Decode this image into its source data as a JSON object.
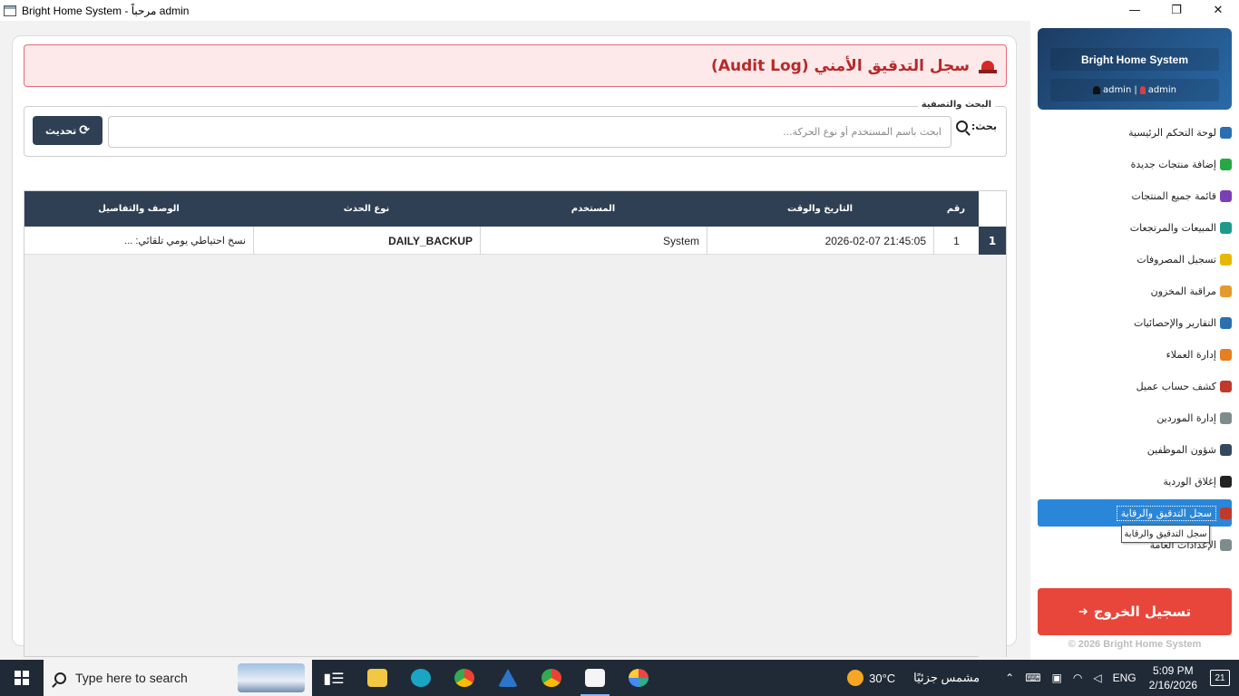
{
  "window": {
    "title": "Bright Home System - مرحباً admin",
    "minimize": "—",
    "maximize": "❐",
    "close": "✕"
  },
  "header": {
    "title": "سجل التدقيق الأمني (Audit Log)"
  },
  "filter": {
    "legend": "البحث والتصفية",
    "search_label": "بحث:",
    "search_placeholder": "ابحث باسم المستخدم أو نوع الحركة...",
    "search_value": "",
    "refresh_label": "تحديث",
    "refresh_icon": "⟳"
  },
  "table": {
    "columns": [
      "رقم",
      "التاريخ والوقت",
      "المستخدم",
      "نوع الحدث",
      "الوصف والتفاصيل"
    ],
    "rows": [
      {
        "row_header": "1",
        "id": "1",
        "datetime": "2026-02-07 21:45:05",
        "user": "System",
        "event_type": "DAILY_BACKUP",
        "description": "نسخ احتياطي يومي تلقائي: ..."
      }
    ]
  },
  "sidebar": {
    "brand_name": "Bright Home System",
    "user_left": "admin",
    "user_sep": "|",
    "user_right": "admin",
    "items": [
      {
        "label": "لوحة التحكم الرئيسية",
        "icon": "dashboard-icon",
        "color": "#2a6fb0"
      },
      {
        "label": "إضافة منتجات جديدة",
        "icon": "plus-circle-icon",
        "color": "#27a844"
      },
      {
        "label": "قائمة جميع المنتجات",
        "icon": "list-icon",
        "color": "#7b3fb5"
      },
      {
        "label": "المبيعات والمرتجعات",
        "icon": "cart-icon",
        "color": "#1f9a8a"
      },
      {
        "label": "تسجيل المصروفات",
        "icon": "receipt-icon",
        "color": "#e6b800"
      },
      {
        "label": "مراقبة المخزون",
        "icon": "boxes-icon",
        "color": "#e59a2f"
      },
      {
        "label": "التقارير والإحصائيات",
        "icon": "bar-chart-icon",
        "color": "#2a6fb0"
      },
      {
        "label": "إدارة العملاء",
        "icon": "users-icon",
        "color": "#e67e22"
      },
      {
        "label": "كشف حساب عميل",
        "icon": "invoice-icon",
        "color": "#c0392b"
      },
      {
        "label": "إدارة الموردين",
        "icon": "truck-icon",
        "color": "#7f8c8d"
      },
      {
        "label": "شؤون الموظفين",
        "icon": "employee-icon",
        "color": "#34495e"
      },
      {
        "label": "إغلاق الوردية",
        "icon": "lock-icon",
        "color": "#222222"
      },
      {
        "label": "سجل التدقيق والرقابة",
        "icon": "shield-icon",
        "color": "#c0392b"
      },
      {
        "label": "الإعدادات العامة",
        "icon": "gear-icon",
        "color": "#7f8c8d"
      }
    ],
    "tooltip": "سجل التدقيق والرقابة",
    "logout_label": "تسجيل الخروج",
    "footer": "© 2026 Bright Home System"
  },
  "taskbar": {
    "search_placeholder": "Type here to search",
    "weather_temp": "30°C",
    "weather_text": "مشمس جزئيًا",
    "lang": "ENG",
    "time": "5:09 PM",
    "date": "2/16/2026",
    "notifications": "21"
  },
  "colors": {
    "accent": "#2a86d8",
    "header_dark": "#2f4054",
    "danger": "#e8463a",
    "alert_bg": "#fde8ea"
  }
}
